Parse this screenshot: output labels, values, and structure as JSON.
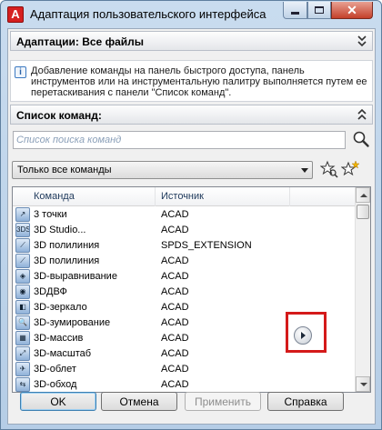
{
  "window": {
    "title": "Адаптация пользовательского интерфейса",
    "app_icon_letter": "A",
    "close_glyph": "✕"
  },
  "adaptations": {
    "header": "Адаптации: Все файлы"
  },
  "info": {
    "text": "Добавление команды на панель быстрого доступа, панель инструментов или на инструментальную палитру выполняется путем ее перетаскивания с панели \"Список команд\"."
  },
  "command_list": {
    "header": "Список команд:",
    "search_placeholder": "Список поиска команд",
    "filter_value": "Только все команды",
    "columns": {
      "command": "Команда",
      "source": "Источник"
    },
    "rows": [
      {
        "name": "3 точки",
        "source": "ACAD",
        "icon": "3point-arc-icon",
        "glyph": "↗"
      },
      {
        "name": "3D Studio...",
        "source": "ACAD",
        "icon": "3d-studio-icon",
        "glyph": "3DS"
      },
      {
        "name": "3D полилиния",
        "source": "SPDS_EXTENSION",
        "icon": "3d-polyline-icon",
        "glyph": "⟋"
      },
      {
        "name": "3D полилиния",
        "source": "ACAD",
        "icon": "3d-polyline-icon",
        "glyph": "⟋"
      },
      {
        "name": "3D-выравнивание",
        "source": "ACAD",
        "icon": "3d-align-icon",
        "glyph": "◈"
      },
      {
        "name": "3DДВФ",
        "source": "ACAD",
        "icon": "3d-dwf-icon",
        "glyph": "◉"
      },
      {
        "name": "3D-зеркало",
        "source": "ACAD",
        "icon": "3d-mirror-icon",
        "glyph": "◧"
      },
      {
        "name": "3D-зумирование",
        "source": "ACAD",
        "icon": "3d-zoom-icon",
        "glyph": "🔍"
      },
      {
        "name": "3D-массив",
        "source": "ACAD",
        "icon": "3d-array-icon",
        "glyph": "▦"
      },
      {
        "name": "3D-масштаб",
        "source": "ACAD",
        "icon": "3d-scale-icon",
        "glyph": "⤢"
      },
      {
        "name": "3D-облет",
        "source": "ACAD",
        "icon": "3d-fly-icon",
        "glyph": "✈"
      },
      {
        "name": "3D-обход",
        "source": "ACAD",
        "icon": "3d-walk-icon",
        "glyph": "⇆"
      }
    ]
  },
  "buttons": {
    "ok": "OK",
    "cancel": "Отмена",
    "apply": "Применить",
    "help": "Справка"
  }
}
